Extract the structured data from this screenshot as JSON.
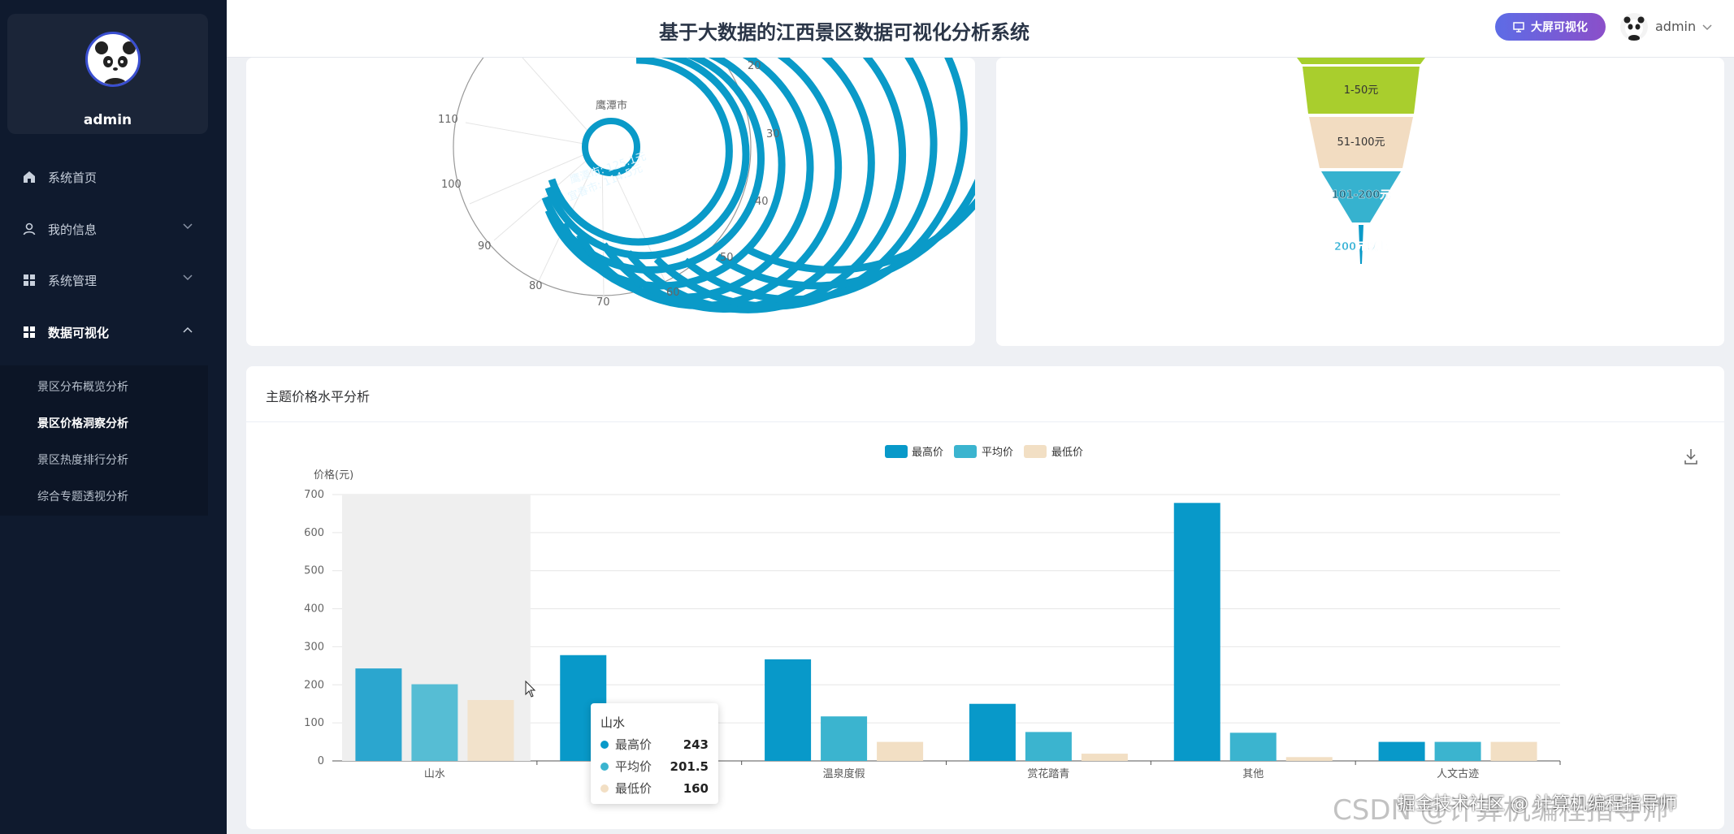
{
  "sidebar": {
    "username": "admin",
    "menu": [
      {
        "label": "系统首页"
      },
      {
        "label": "我的信息"
      },
      {
        "label": "系统管理"
      },
      {
        "label": "数据可视化"
      }
    ],
    "submenu": [
      {
        "label": "景区分布概览分析"
      },
      {
        "label": "景区价格洞察分析"
      },
      {
        "label": "景区热度排行分析"
      },
      {
        "label": "综合专题透视分析"
      }
    ]
  },
  "header": {
    "title": "基于大数据的江西景区数据可视化分析系统",
    "bigscreen_label": "大屏可视化",
    "username": "admin"
  },
  "polar_chart": {
    "city_label": "鹰潭市",
    "ticks": [
      "20",
      "30",
      "40",
      "50",
      "60",
      "70",
      "80",
      "90",
      "100",
      "110"
    ],
    "visible_bar_labels": [
      "鹰潭市: 125.1元",
      "宜春市: 114.5元"
    ]
  },
  "funnel_chart": {
    "labels": [
      "1-50元",
      "51-100元",
      "101-200元",
      "200元以上"
    ]
  },
  "price_card": {
    "title": "主题价格水平分析"
  },
  "chart_data": {
    "type": "bar",
    "ylabel": "价格(元)",
    "ylim": [
      0,
      700
    ],
    "yticks": [
      "0",
      "100",
      "200",
      "300",
      "400",
      "500",
      "600",
      "700"
    ],
    "categories": [
      "山水",
      "",
      "温泉度假",
      "赏花踏青",
      "其他",
      "人文古迹"
    ],
    "series": [
      {
        "name": "最高价",
        "color": "#0899c9",
        "values": [
          243,
          278,
          267,
          150,
          678,
          50
        ]
      },
      {
        "name": "平均价",
        "color": "#3bb4cf",
        "values": [
          201.5,
          0,
          117,
          76,
          74,
          50
        ]
      },
      {
        "name": "最低价",
        "color": "#f2dfc4",
        "values": [
          160,
          0,
          50,
          19,
          10,
          50
        ]
      }
    ]
  },
  "tooltip": {
    "title": "山水",
    "rows": [
      {
        "name": "最高价",
        "value": "243",
        "color": "#0899c9"
      },
      {
        "name": "平均价",
        "value": "201.5",
        "color": "#3bb4cf"
      },
      {
        "name": "最低价",
        "value": "160",
        "color": "#f2dfc4"
      }
    ]
  },
  "watermark": "CSDN @计算机编程指导师",
  "watermark2": "掘金技术社区 @ 计算机编程指导师"
}
